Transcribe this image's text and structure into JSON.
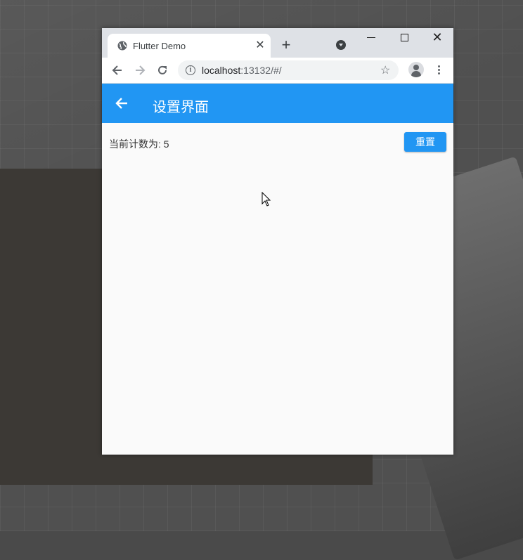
{
  "browser": {
    "tab_title": "Flutter Demo",
    "tab_close": "✕",
    "new_tab": "+",
    "window_close": "✕",
    "url_host": "localhost",
    "url_rest": ":13132/#/"
  },
  "app": {
    "title": "设置界面",
    "counter_text": "当前计数为: 5",
    "reset_label": "重置",
    "accent_color": "#2196f3"
  },
  "icons": {
    "favicon": "globe-icon",
    "back": "arrow-left-icon",
    "reload": "reload-icon",
    "info": "info-icon",
    "bookmark": "star-icon",
    "profile": "avatar-icon",
    "menu": "kebab-menu-icon"
  }
}
